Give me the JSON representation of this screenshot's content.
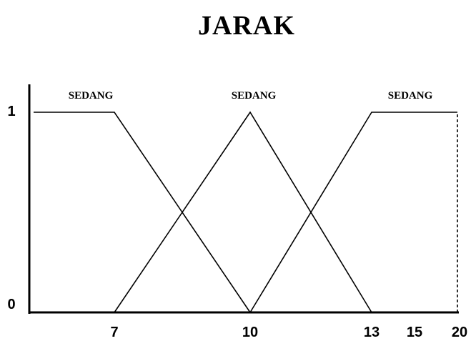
{
  "chart_data": {
    "type": "line",
    "title": "JARAK",
    "xlabel": "",
    "ylabel": "",
    "x_tick_labels": [
      "7",
      "10",
      "13",
      "15",
      "20"
    ],
    "y_tick_labels": [
      "0",
      "1"
    ],
    "ylim": [
      0,
      1
    ],
    "grid": false,
    "legend": "none",
    "series": [
      {
        "name": "SEDANG",
        "x": [
          4,
          7,
          10
        ],
        "y": [
          1,
          1,
          0
        ]
      },
      {
        "name": "SEDANG",
        "x": [
          7,
          10,
          13
        ],
        "y": [
          0,
          1,
          0
        ]
      },
      {
        "name": "SEDANG",
        "x": [
          10,
          13,
          20
        ],
        "y": [
          0,
          1,
          1
        ]
      }
    ],
    "annotations": [
      {
        "type": "dashed-vertical",
        "x": 20,
        "y": [
          0,
          1
        ]
      }
    ],
    "colors": {
      "line": "#000000",
      "axis": "#000000"
    }
  }
}
